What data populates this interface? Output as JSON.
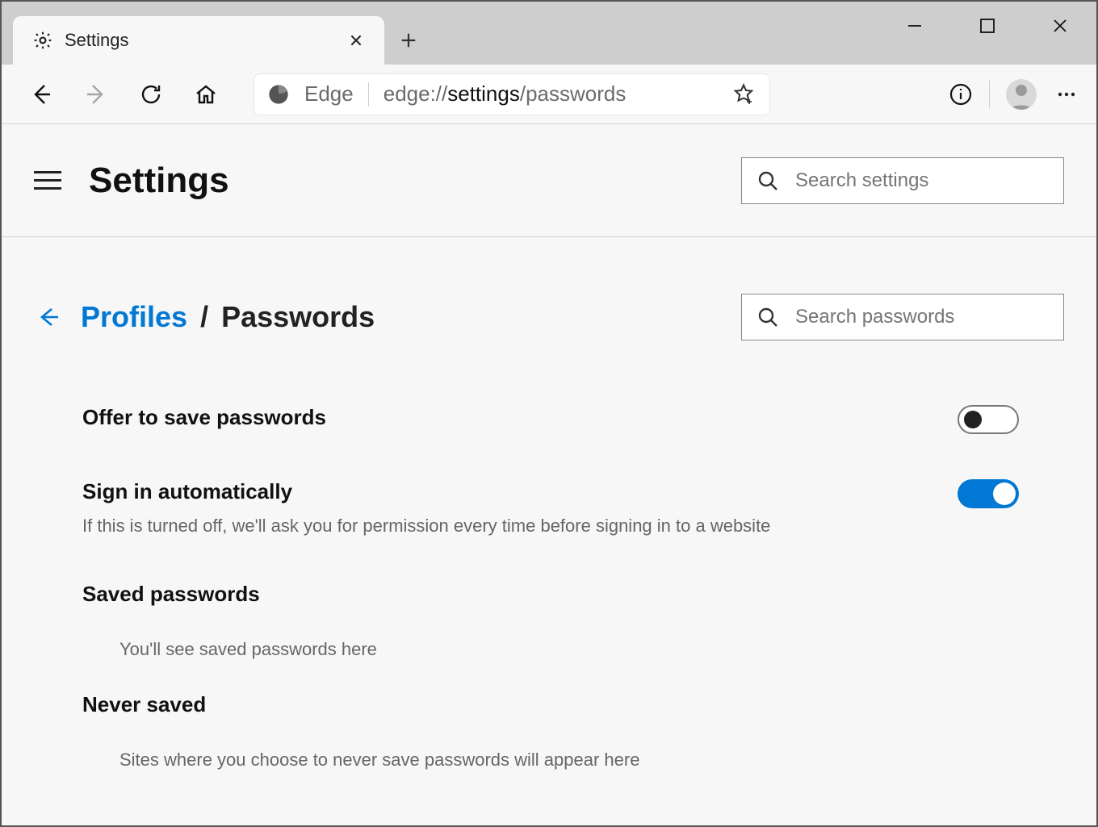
{
  "window": {
    "tab_title": "Settings"
  },
  "toolbar": {
    "edge_label": "Edge",
    "url_prefix": "edge://",
    "url_bold": "settings",
    "url_suffix": "/passwords"
  },
  "header": {
    "title": "Settings",
    "search_placeholder": "Search settings"
  },
  "breadcrumb": {
    "parent": "Profiles",
    "separator": "/",
    "current": "Passwords",
    "search_placeholder": "Search passwords"
  },
  "settings": {
    "offer_save": {
      "title": "Offer to save passwords",
      "enabled": false
    },
    "auto_signin": {
      "title": "Sign in automatically",
      "description": "If this is turned off, we'll ask you for permission every time before signing in to a website",
      "enabled": true
    },
    "saved": {
      "title": "Saved passwords",
      "empty": "You'll see saved passwords here"
    },
    "never": {
      "title": "Never saved",
      "empty": "Sites where you choose to never save passwords will appear here"
    }
  }
}
